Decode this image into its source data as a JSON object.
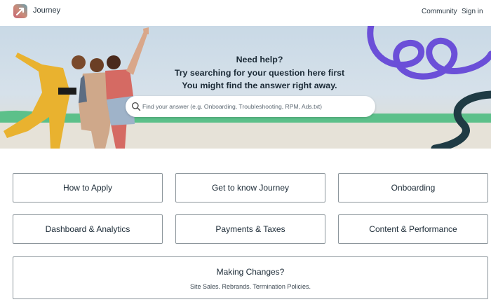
{
  "header": {
    "brand": "Journey",
    "nav": {
      "community": "Community",
      "signin": "Sign in"
    }
  },
  "hero": {
    "line1": "Need help?",
    "line2": "Try searching for your question here first",
    "line3": "You might find the answer right away.",
    "search": {
      "placeholder": "Find your answer (e.g. Onboarding, Troubleshooting, RPM, Ads.txt)",
      "value": ""
    }
  },
  "categories": [
    {
      "label": "How to Apply"
    },
    {
      "label": "Get to know Journey"
    },
    {
      "label": "Onboarding"
    },
    {
      "label": "Dashboard & Analytics"
    },
    {
      "label": "Payments & Taxes"
    },
    {
      "label": "Content & Performance"
    }
  ],
  "wide_card": {
    "title": "Making Changes?",
    "subtitle": "Site Sales. Rebrands. Termination Policies."
  },
  "colors": {
    "accent_purple": "#6b4fd8",
    "stripe_green": "#5cc08a",
    "dark_teal": "#1f3b44"
  },
  "icons": [
    "journey-logo-icon",
    "search-icon"
  ]
}
